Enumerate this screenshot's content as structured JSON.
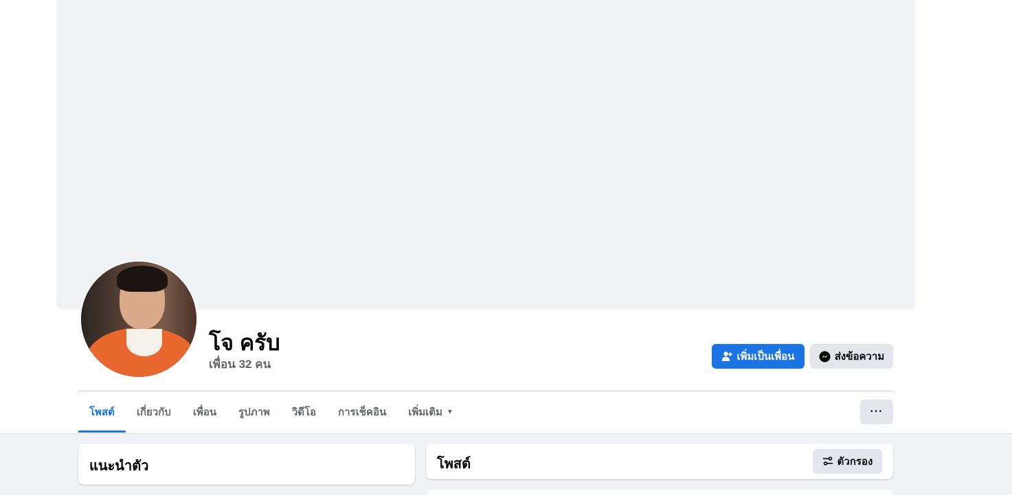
{
  "profile": {
    "name": "โจ ครับ",
    "friend_count": "เพื่อน 32 คน"
  },
  "actions": {
    "add_friend_label": "เพิ่มเป็นเพื่อน",
    "message_label": "ส่งข้อความ",
    "more_label": "···"
  },
  "tabs": [
    {
      "label": "โพสต์",
      "active": true
    },
    {
      "label": "เกี่ยวกับ",
      "active": false
    },
    {
      "label": "เพื่อน",
      "active": false
    },
    {
      "label": "รูปภาพ",
      "active": false
    },
    {
      "label": "วิดีโอ",
      "active": false
    },
    {
      "label": "การเช็คอิน",
      "active": false
    },
    {
      "label": "เพิ่มเติม",
      "active": false
    }
  ],
  "intro": {
    "title": "แนะนำตัว"
  },
  "posts": {
    "title": "โพสต์",
    "filter_label": "ตัวกรอง"
  },
  "colors": {
    "accent": "#1b74e4",
    "secondary_button": "#e4e6eb",
    "cover": "#f0f2f5",
    "muted_text": "#65676b"
  }
}
